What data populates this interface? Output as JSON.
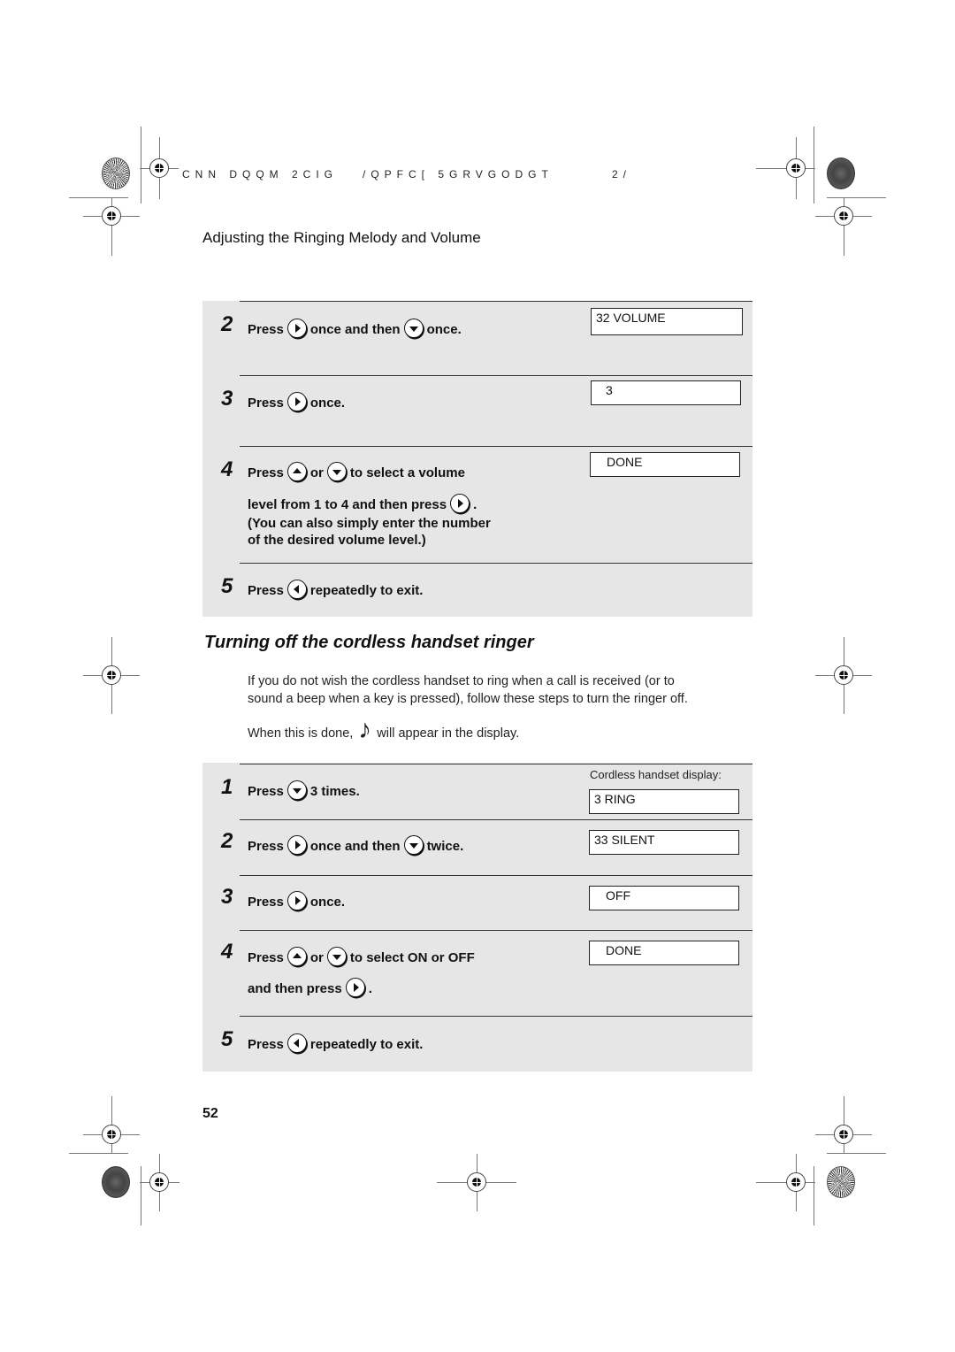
{
  "header": {
    "code": "CNN DQQM 2CIG   /QPFC[ 5GRVGODGT",
    "page_code": "2/"
  },
  "section_title": "Adjusting the Ringing Melody and Volume",
  "volume_steps": [
    {
      "num": "2",
      "parts": [
        "Press",
        "right-key",
        "once and then",
        "down-key",
        "once."
      ],
      "display": "32 VOLUME"
    },
    {
      "num": "3",
      "parts": [
        "Press",
        "right-key",
        "once."
      ],
      "display": "3"
    },
    {
      "num": "4",
      "line1": [
        "Press",
        "up-key",
        "or",
        "down-key",
        "to select a volume"
      ],
      "line2": [
        "level from 1 to 4 and then press",
        "right-key",
        "."
      ],
      "line3": "(You can also simply enter the number",
      "line4": "of the desired volume level.)",
      "display": "DONE"
    },
    {
      "num": "5",
      "parts": [
        "Press",
        "left-key",
        "repeatedly to exit."
      ]
    }
  ],
  "ringer_section": {
    "title": "Turning off the cordless handset ringer",
    "para_line1": "If you do not wish the cordless handset to ring when a call is received (or to",
    "para_line2": "sound a beep when a key is pressed), follow these steps to turn the ringer off.",
    "when_done_before": "When this is done,",
    "when_done_icon": "music-note-off-icon",
    "when_done_after": "will appear in the display.",
    "display_caption": "Cordless handset display:"
  },
  "ringer_steps": [
    {
      "num": "1",
      "parts": [
        "Press",
        "down-key",
        "3 times."
      ],
      "display": "3  RING"
    },
    {
      "num": "2",
      "parts": [
        "Press",
        "right-key",
        "once and then",
        "down-key",
        "twice."
      ],
      "display": "33 SILENT"
    },
    {
      "num": "3",
      "parts": [
        "Press",
        "right-key",
        "once."
      ],
      "display": "OFF"
    },
    {
      "num": "4",
      "line1": [
        "Press",
        "up-key",
        "or",
        "down-key",
        "to select ON or OFF"
      ],
      "line2": [
        "and then press",
        "right-key",
        "."
      ],
      "display": "DONE"
    },
    {
      "num": "5",
      "parts": [
        "Press",
        "left-key",
        "repeatedly to exit."
      ]
    }
  ],
  "page_number": "52",
  "colors": {
    "panel_bg": "#e6e6e6",
    "text": "#111111"
  }
}
